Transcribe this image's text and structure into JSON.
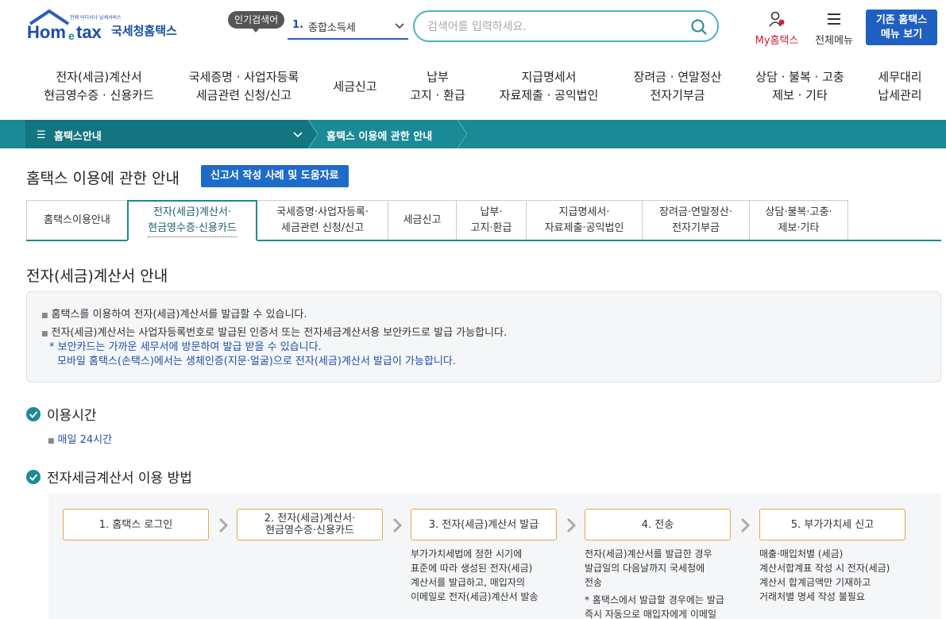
{
  "header": {
    "logo_text": "Hometax.",
    "logo_tagline": "언제 어디서나 납세서비스",
    "brand": "국세청홈택스",
    "popular_label": "인기검색어",
    "popular_rank": "1.",
    "popular_term": "종합소득세",
    "search_placeholder": "검색어를 입력하세요.",
    "my_label": "My홈택스",
    "all_menu_label": "전체메뉴",
    "legacy_button": [
      "기존 홈택스",
      "메뉴 보기"
    ]
  },
  "gnb": [
    [
      "전자(세금)계산서",
      "현금영수증 · 신용카드"
    ],
    [
      "국세증명 · 사업자등록",
      "세금관련 신청/신고"
    ],
    [
      "세금신고"
    ],
    [
      "납부",
      "고지 · 환급"
    ],
    [
      "지급명세서",
      "자료제출 · 공익법인"
    ],
    [
      "장려금 · 연말정산",
      "전자기부금"
    ],
    [
      "상담 · 불복 · 고충",
      "제보 · 기타"
    ],
    [
      "세무대리",
      "납세관리"
    ]
  ],
  "breadcrumb": {
    "level1": "홈택스안내",
    "level2": "홈택스 이용에 관한 안내"
  },
  "page": {
    "title": "홈택스 이용에 관한 안내",
    "help_button": "신고서 작성 사례 및 도움자료"
  },
  "tabs": [
    [
      "홈택스이용안내"
    ],
    [
      "전자(세금)계산서·",
      "현금영수증·신용카드"
    ],
    [
      "국세증명·사업자등록·",
      "세금관련 신청/신고"
    ],
    [
      "세금신고"
    ],
    [
      "납부·",
      "고지·환급"
    ],
    [
      "지급명세서·",
      "자료제출·공익법인"
    ],
    [
      "장려금·연말정산·",
      "전자기부금"
    ],
    [
      "상담·불복·고충·",
      "제보·기타"
    ]
  ],
  "active_tab_index": 1,
  "section": {
    "title": "전자(세금)계산서 안내",
    "info_lines": [
      "홈택스를 이용하여 전자(세금)계산서를 발급할 수 있습니다.",
      "전자(세금)계산서는 사업자등록번호로 발급된 인증서 또는 전자세금계산서용 보안카드로 발급 가능합니다.",
      "* 보안카드는 가까운 세무서에 방문하여 발급 받을 수 있습니다.",
      "모바일 홈택스(손택스)에서는 생체인증(지문·얼굴)으로 전자(세금)계산서 발급이 가능합니다."
    ]
  },
  "usage_time": {
    "title": "이용시간",
    "value": "매일 24시간"
  },
  "usage_method": {
    "title": "전자세금계산서 이용 방법",
    "steps": [
      {
        "label": [
          "1. 홈택스 로그인"
        ],
        "desc": []
      },
      {
        "label": [
          "2. 전자(세금)계산서·",
          "현금영수증·신용카드"
        ],
        "desc": []
      },
      {
        "label": [
          "3. 전자(세금)계산서 발급"
        ],
        "desc": [
          "부가가치세법에 정한 시기에",
          "표준에 따라 생성된 전자(세금)",
          "계산서를 발급하고, 매입자의",
          "이메일로 전자(세금)계산서 발송"
        ]
      },
      {
        "label": [
          "4. 전송"
        ],
        "desc": [
          "전자(세금)계산서를 발급한 경우",
          "발급일의 다음날까지 국세청에",
          "전송",
          "* 홈택스에서 발급할 경우에는 발급",
          "즉시 자동으로 매입자에게 이메일"
        ]
      },
      {
        "label": [
          "5. 부가가치세 신고"
        ],
        "desc": [
          "매출·매입처별 (세금)",
          "계산서합계표 작성 시 전자(세금)",
          "계산서 합계금액만 기재하고",
          "거래처별 명세 작성 불필요"
        ]
      }
    ]
  },
  "colors": {
    "teal": "#1a8a96",
    "navy": "#1a4fa3",
    "blue_button": "#1f5fbf",
    "accent_red": "#c8243c",
    "step_border": "#e4a94a"
  }
}
